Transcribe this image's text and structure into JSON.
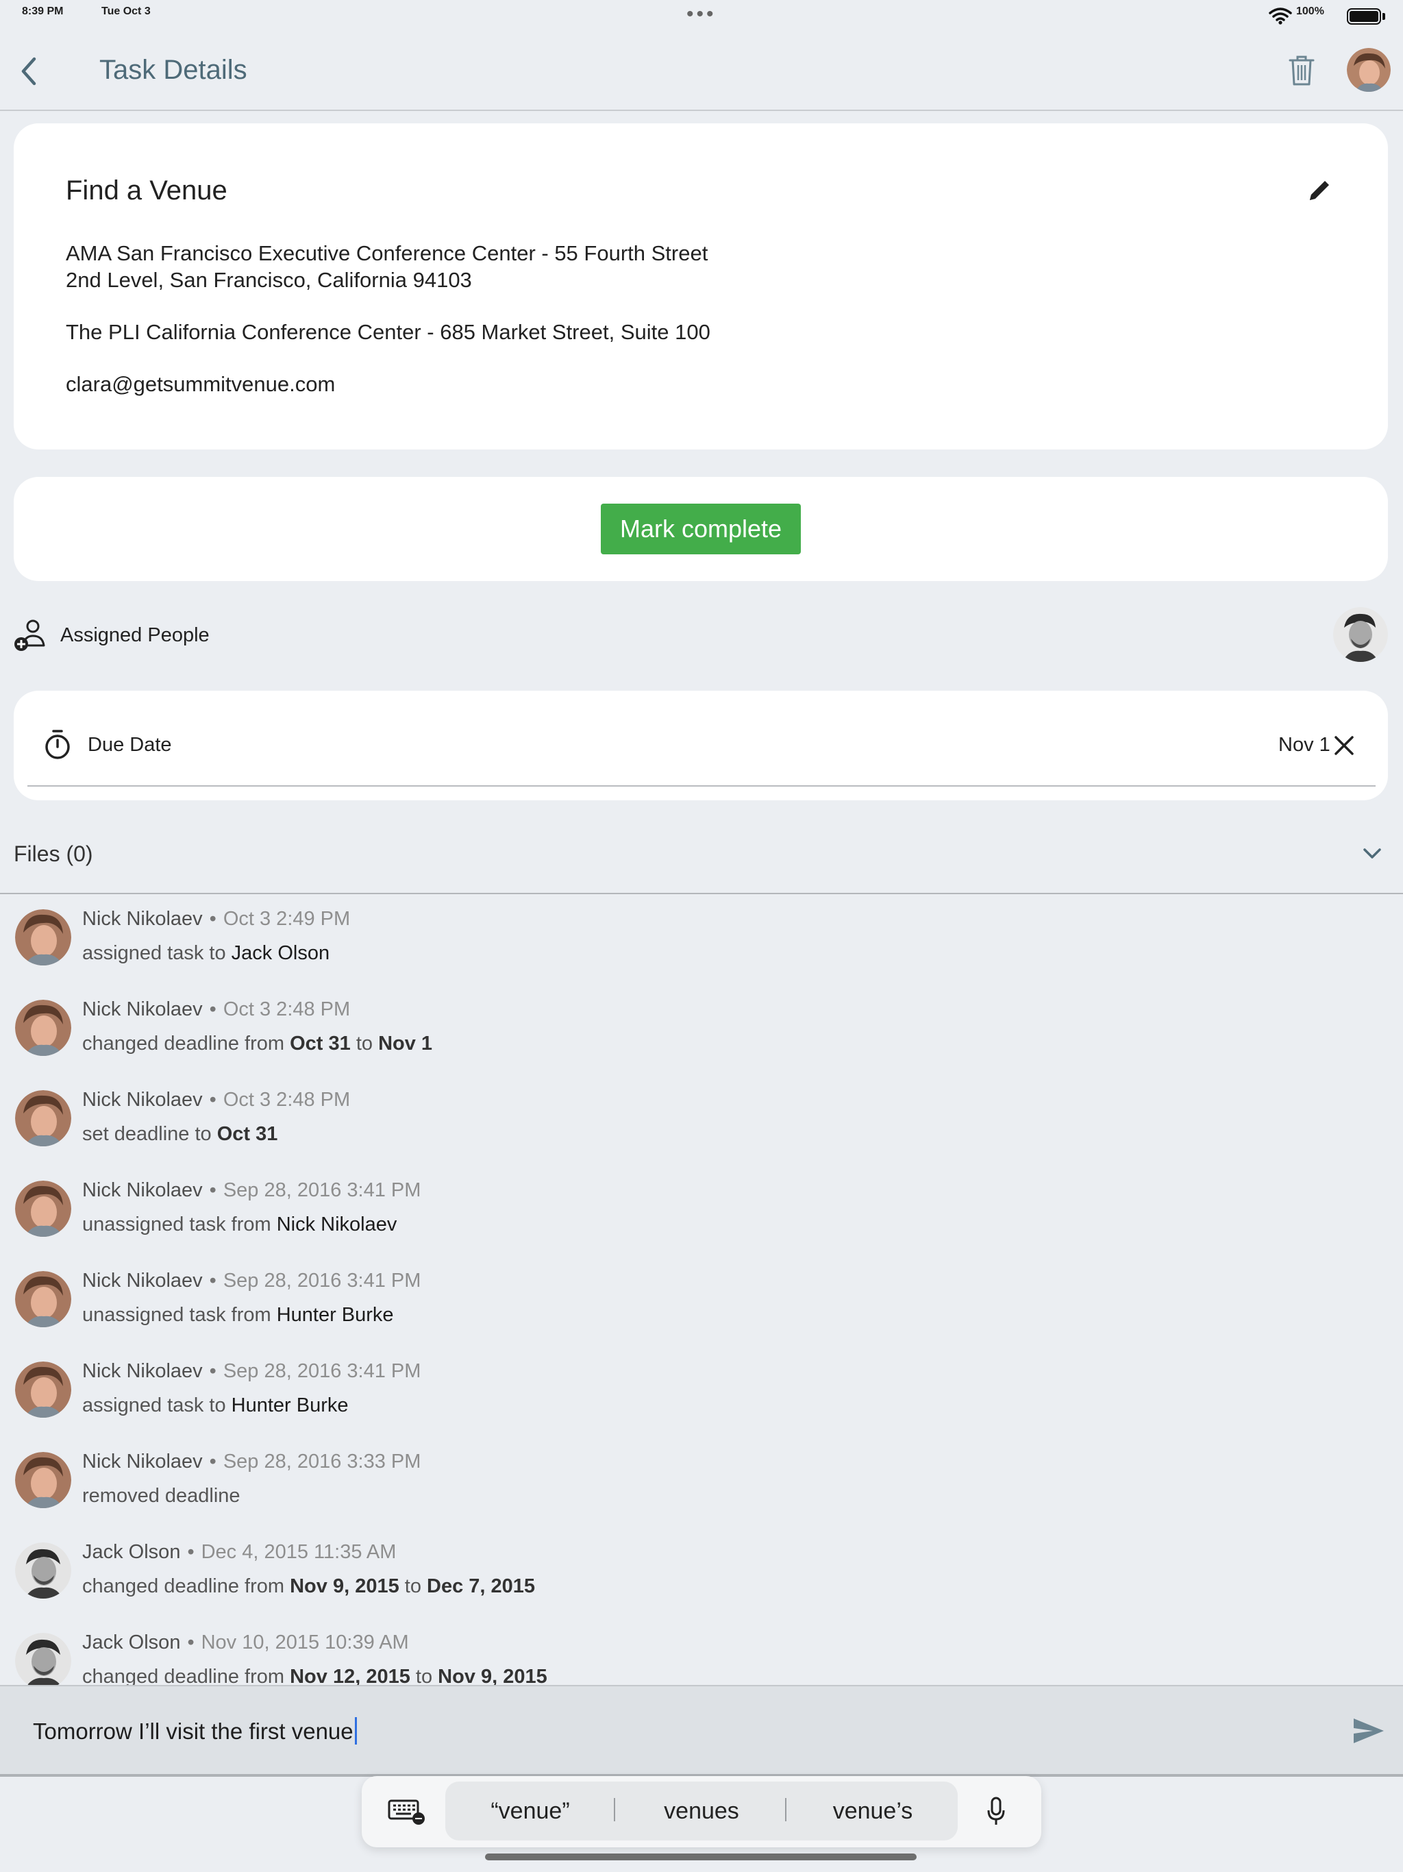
{
  "status_bar": {
    "time": "8:39 PM",
    "date": "Tue Oct 3",
    "battery": "100%"
  },
  "nav": {
    "title": "Task Details"
  },
  "task": {
    "title": "Find a Venue",
    "lines": [
      "AMA San Francisco Executive Conference Center - 55 Fourth Street",
      "2nd Level, San Francisco, California 94103",
      "The PLI California Conference Center - 685 Market Street, Suite 100",
      "clara@getsummitvenue.com"
    ]
  },
  "complete_button": "Mark complete",
  "assigned": {
    "label": "Assigned People"
  },
  "due": {
    "label": "Due Date",
    "value": "Nov 1"
  },
  "files": {
    "label": "Files (0)"
  },
  "activity": [
    {
      "name": "Nick Nikolaev",
      "time": "Oct 3 2:49 PM",
      "action": "assigned task to ",
      "target": "Jack Olson"
    },
    {
      "name": "Nick Nikolaev",
      "time": "Oct 3 2:48 PM",
      "action": "changed deadline from ",
      "from": "Oct 31",
      "mid": " to ",
      "to": "Nov 1"
    },
    {
      "name": "Nick Nikolaev",
      "time": "Oct 3 2:48 PM",
      "action": "set deadline to ",
      "to": "Oct 31"
    },
    {
      "name": "Nick Nikolaev",
      "time": "Sep 28, 2016 3:41 PM",
      "action": "unassigned task from ",
      "target": "Nick Nikolaev"
    },
    {
      "name": "Nick Nikolaev",
      "time": "Sep 28, 2016 3:41 PM",
      "action": "unassigned task from ",
      "target": "Hunter Burke"
    },
    {
      "name": "Nick Nikolaev",
      "time": "Sep 28, 2016 3:41 PM",
      "action": "assigned task to ",
      "target": "Hunter Burke"
    },
    {
      "name": "Nick Nikolaev",
      "time": "Sep 28, 2016 3:33 PM",
      "action": "removed deadline"
    },
    {
      "name": "Jack Olson",
      "time": "Dec 4, 2015 11:35 AM",
      "action": "changed deadline from ",
      "from": "Nov 9, 2015",
      "mid": " to ",
      "to": "Dec 7, 2015"
    },
    {
      "name": "Jack Olson",
      "time": "Nov 10, 2015 10:39 AM",
      "action": "changed deadline from ",
      "from": "Nov 12, 2015",
      "mid": " to ",
      "to": "Nov 9, 2015"
    }
  ],
  "composer": {
    "text": "Tomorrow I’ll visit the first venue"
  },
  "keyboard": {
    "suggestions": [
      "“venue”",
      "venues",
      "venue’s"
    ]
  },
  "colors": {
    "accent_green": "#43ad4a",
    "title_blue": "#4e6a78",
    "background": "#ebeef2"
  }
}
